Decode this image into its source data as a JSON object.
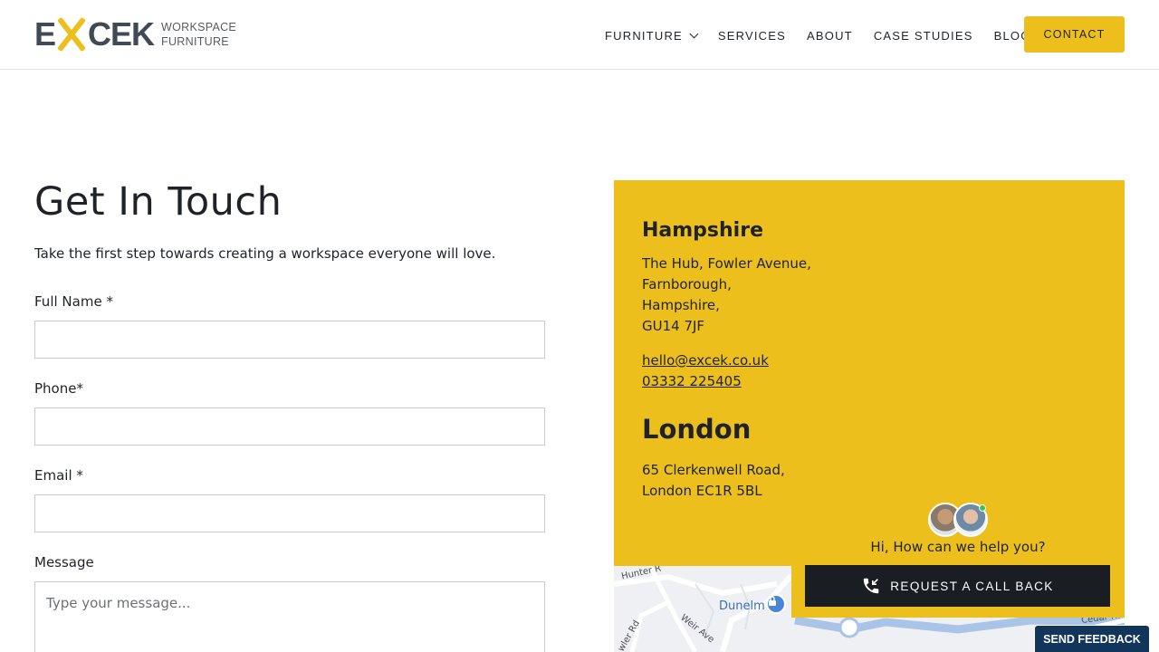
{
  "brand": {
    "logo_left": "E",
    "logo_right": "CEK",
    "subline_1": "WORKSPACE",
    "subline_2": "FURNITURE",
    "accent_color": "#ecbf1d",
    "dark_color": "#3f4a56"
  },
  "nav": {
    "items": [
      {
        "label": "FURNITURE",
        "has_dropdown": true
      },
      {
        "label": "SERVICES"
      },
      {
        "label": "ABOUT"
      },
      {
        "label": "CASE STUDIES"
      },
      {
        "label": "BLOG"
      }
    ],
    "cta_label": "CONTACT"
  },
  "form": {
    "title": "Get In Touch",
    "intro": "Take the first step towards creating a workspace everyone will love.",
    "full_name_label": "Full Name *",
    "full_name_value": "",
    "phone_label": "Phone*",
    "phone_value": "",
    "email_label": "Email *",
    "email_value": "",
    "message_label": "Message",
    "message_placeholder": "Type your message..."
  },
  "offices": {
    "hampshire": {
      "name": "Hampshire",
      "address_lines": [
        "The Hub, Fowler Avenue,",
        "Farnborough,",
        "Hampshire,",
        "GU14 7JF"
      ],
      "email": "hello@excek.co.uk",
      "phone": "03332 225405"
    },
    "london": {
      "name": "London",
      "address_lines": [
        "65 Clerkenwell Road,",
        "London EC1R 5BL"
      ]
    }
  },
  "map": {
    "place_label": "Dunelm",
    "streets": [
      "Hunter R",
      "wler Rd",
      "Weir Ave",
      "Cedar Ra"
    ]
  },
  "chat": {
    "message": "Hi, How can we help you?",
    "button_label": "REQUEST A CALL BACK",
    "status": "online"
  },
  "feedback": {
    "label": "SEND FEEDBACK",
    "color": "#12355b"
  }
}
